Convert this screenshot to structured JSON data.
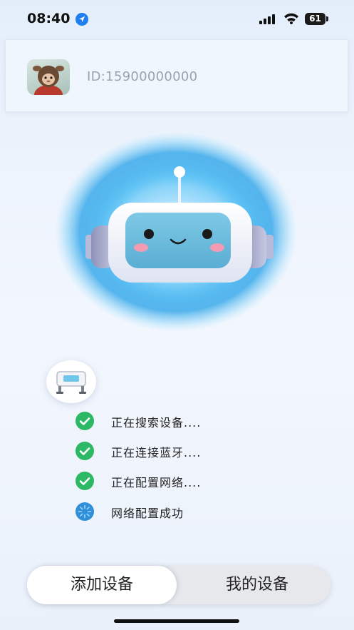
{
  "status_bar": {
    "time": "08:40",
    "battery": "61",
    "icons": [
      "location-arrow-icon",
      "cellular-signal-icon",
      "wifi-icon",
      "battery-icon"
    ]
  },
  "profile": {
    "user_id": "ID:15900000000",
    "avatar_icon": "plush-doll-avatar"
  },
  "hero": {
    "icon": "robot-headphones-icon",
    "glow_color": "#3fb4f0"
  },
  "device": {
    "icon": "robot-vacuum-icon"
  },
  "steps": [
    {
      "label": "正在搜索设备....",
      "icon": "check-circle-icon",
      "status": "done",
      "color": "#2cb865"
    },
    {
      "label": "正在连接蓝牙....",
      "icon": "check-circle-icon",
      "status": "done",
      "color": "#2cb865"
    },
    {
      "label": "正在配置网络....",
      "icon": "check-circle-icon",
      "status": "done",
      "color": "#2cb865"
    },
    {
      "label": "网络配置成功",
      "icon": "loading-spinner-icon",
      "status": "in-progress",
      "color": "#2f8fd8"
    }
  ],
  "tabs": [
    {
      "label": "添加设备",
      "active": true
    },
    {
      "label": "我的设备",
      "active": false
    }
  ]
}
